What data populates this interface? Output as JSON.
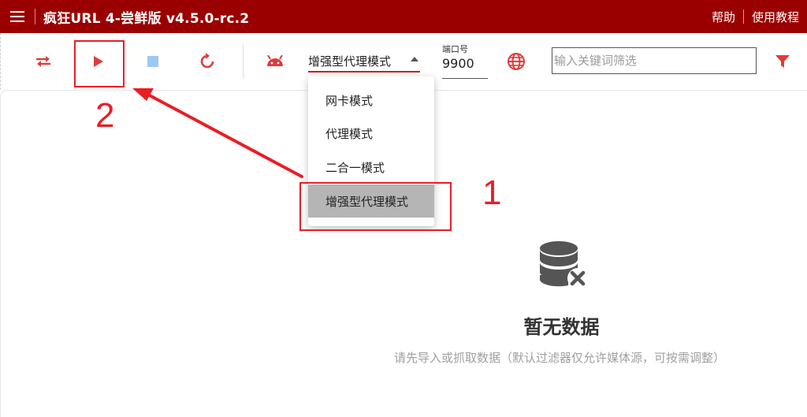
{
  "app": {
    "title": "疯狂URL 4-尝鲜版 v4.5.0-rc.2",
    "links": {
      "help": "帮助",
      "tutorial": "使用教程"
    },
    "brand_color": "#9b0000",
    "accent_color": "#e03b3b"
  },
  "toolbar": {
    "icons": [
      "swap-icon",
      "play-icon",
      "stop-icon",
      "refresh-icon",
      "android-icon",
      "globe-icon",
      "filter-icon"
    ],
    "mode_select": {
      "value": "增强型代理模式"
    },
    "port": {
      "label": "端口号",
      "value": "9900"
    },
    "filter": {
      "placeholder": "输入关键词筛选",
      "value": ""
    }
  },
  "dropdown": {
    "options": [
      {
        "label": "网卡模式",
        "selected": false
      },
      {
        "label": "代理模式",
        "selected": false
      },
      {
        "label": "二合一模式",
        "selected": false
      },
      {
        "label": "增强型代理模式",
        "selected": true
      }
    ]
  },
  "empty_state": {
    "icon": "database-x-icon",
    "title": "暂无数据",
    "subtitle": "请先导入或抓取数据（默认过滤器仅允许媒体源，可按需调整）"
  },
  "annotations": {
    "step1": "1",
    "step2": "2",
    "color": "#ec1c24"
  }
}
